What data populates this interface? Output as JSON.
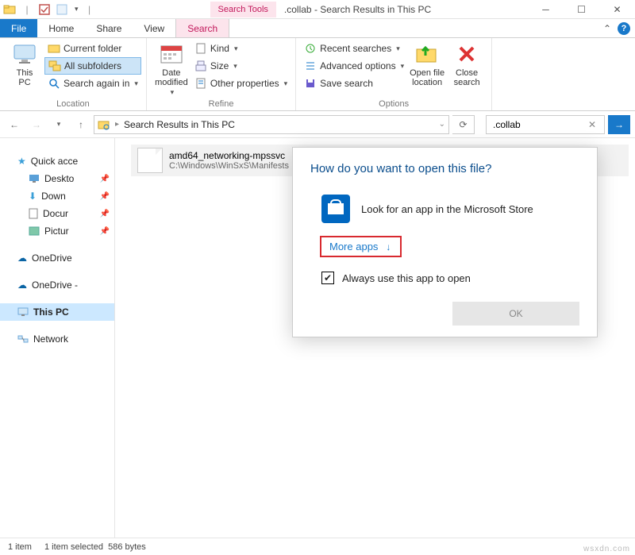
{
  "titlebar": {
    "contextual_label": "Search Tools",
    "window_title": ".collab - Search Results in This PC"
  },
  "tabs": {
    "file": "File",
    "home": "Home",
    "share": "Share",
    "view": "View",
    "search": "Search"
  },
  "ribbon": {
    "location": {
      "this_pc": "This\nPC",
      "current_folder": "Current folder",
      "all_subfolders": "All subfolders",
      "search_again": "Search again in",
      "group": "Location"
    },
    "refine": {
      "date_modified": "Date\nmodified",
      "kind": "Kind",
      "size": "Size",
      "other_props": "Other properties",
      "group": "Refine"
    },
    "options": {
      "recent": "Recent searches",
      "advanced": "Advanced options",
      "save": "Save search",
      "open_loc": "Open file\nlocation",
      "close": "Close\nsearch",
      "group": "Options"
    }
  },
  "address": {
    "crumb1": "Search Results in This PC",
    "search_value": ".collab"
  },
  "nav": {
    "quick": "Quick acce",
    "desktop": "Deskto",
    "down": "Down",
    "docs": "Docur",
    "pics": "Pictur",
    "onedrive1": "OneDrive",
    "onedrive2": "OneDrive -",
    "thispc": "This PC",
    "network": "Network"
  },
  "result": {
    "name": "amd64_networking-mpssvc",
    "path": "C:\\Windows\\WinSxS\\Manifests"
  },
  "dialog": {
    "title": "How do you want to open this file?",
    "store": "Look for an app in the Microsoft Store",
    "more": "More apps",
    "always": "Always use this app to open",
    "ok": "OK"
  },
  "status": {
    "count": "1 item",
    "selected": "1 item selected",
    "size": "586 bytes"
  },
  "watermark": "wsxdn.com"
}
